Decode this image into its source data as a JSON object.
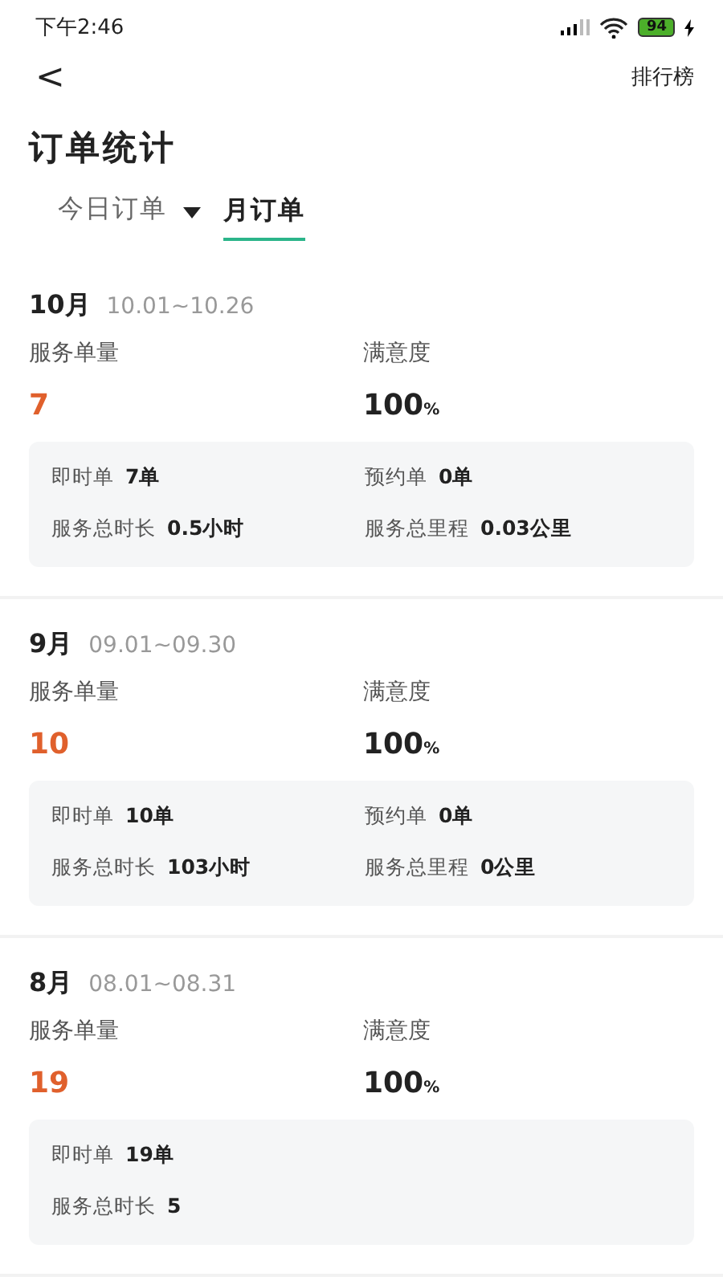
{
  "status_bar": {
    "time": "下午2:46",
    "battery": "94"
  },
  "nav": {
    "back": "<",
    "action": "排行榜"
  },
  "title": "订单统计",
  "tabs": [
    {
      "label": "今日订单",
      "selected": false,
      "dropdown": true
    },
    {
      "label": "月订单",
      "selected": true,
      "dropdown": false
    }
  ],
  "months": [
    {
      "month": "10月",
      "range": "10.01~10.26",
      "count_label": "服务单量",
      "count": "7",
      "satisfaction_label": "满意度",
      "satisfaction": "100",
      "satisfaction_unit": "%",
      "details": [
        [
          {
            "label": "即时单",
            "value": "7单"
          },
          {
            "label": "预约单",
            "value": "0单"
          }
        ],
        [
          {
            "label": "服务总时长",
            "value": "0.5小时"
          },
          {
            "label": "服务总里程",
            "value": "0.03公里"
          }
        ]
      ]
    },
    {
      "month": "9月",
      "range": "09.01~09.30",
      "count_label": "服务单量",
      "count": "10",
      "satisfaction_label": "满意度",
      "satisfaction": "100",
      "satisfaction_unit": "%",
      "details": [
        [
          {
            "label": "即时单",
            "value": "10单"
          },
          {
            "label": "预约单",
            "value": "0单"
          }
        ],
        [
          {
            "label": "服务总时长",
            "value": "103小时"
          },
          {
            "label": "服务总里程",
            "value": "0公里"
          }
        ]
      ]
    },
    {
      "month": "8月",
      "range": "08.01~08.31",
      "count_label": "服务单量",
      "count": "19",
      "satisfaction_label": "满意度",
      "satisfaction": "100",
      "satisfaction_unit": "%",
      "details": [
        [
          {
            "label": "即时单",
            "value": "19单"
          }
        ],
        [
          {
            "label": "服务总时长",
            "value": "5"
          }
        ]
      ]
    }
  ]
}
